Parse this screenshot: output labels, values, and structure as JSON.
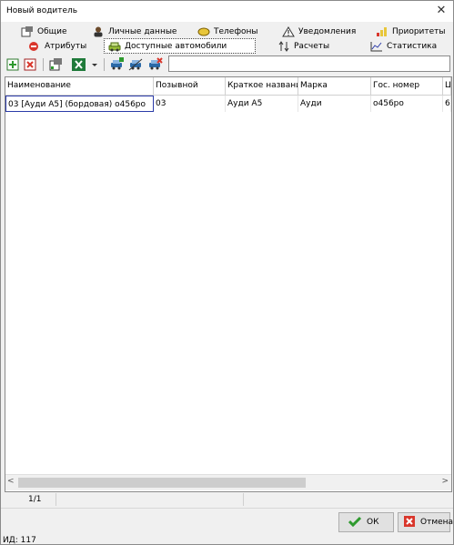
{
  "window": {
    "title": "Новый водитель"
  },
  "tabs_row1": [
    {
      "label": "Общие",
      "icon": "general-icon"
    },
    {
      "label": "Личные данные",
      "icon": "person-icon"
    },
    {
      "label": "Телефоны",
      "icon": "phone-icon"
    },
    {
      "label": "Уведомления",
      "icon": "warning-icon"
    },
    {
      "label": "Приоритеты",
      "icon": "priority-icon"
    }
  ],
  "tabs_row2": [
    {
      "label": "Атрибуты",
      "icon": "attributes-icon"
    },
    {
      "label": "Доступные автомобили",
      "icon": "car-icon",
      "active": true
    },
    {
      "label": "Расчеты",
      "icon": "sort-arrows-icon"
    },
    {
      "label": "Статистика",
      "icon": "chart-icon"
    }
  ],
  "toolbar": {
    "search_value": ""
  },
  "grid": {
    "columns": [
      "Наименование",
      "Позывной",
      "Краткое название",
      "Марка",
      "Гос. номер",
      "Ц"
    ],
    "rows": [
      [
        "03 [Ауди А5] (бордовая) о456ро",
        "03",
        "Ауди А5",
        "Ауди",
        "о456ро",
        "6"
      ]
    ]
  },
  "status": {
    "pager": "1/1"
  },
  "buttons": {
    "ok": "ОК",
    "cancel": "Отмена"
  },
  "footer": {
    "id_text": "ИД: 117"
  },
  "colors": {
    "selection_border": "#2b3ba8",
    "ok_green": "#2e9a2e",
    "cancel_red": "#d9362b"
  }
}
